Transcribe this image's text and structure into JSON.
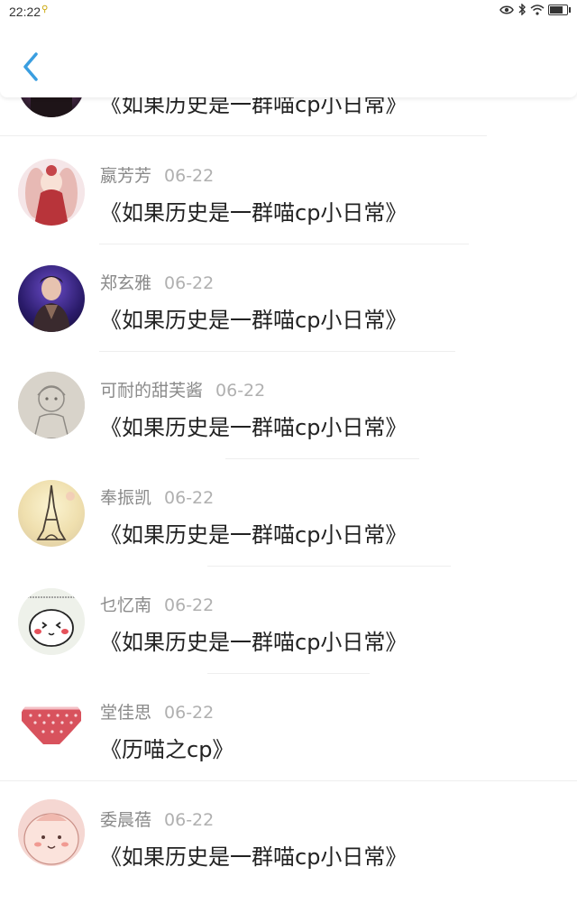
{
  "status": {
    "time": "22:22",
    "battery_level": 0.7
  },
  "nav": {
    "back_icon": "chevron-left-icon",
    "accent": "#3a9ee0"
  },
  "items": [
    {
      "title": "《如果历史是一群喵cp小日常》"
    },
    {
      "name": "嬴芳芳",
      "date": "06-22",
      "title": "《如果历史是一群喵cp小日常》"
    },
    {
      "name": "郑玄雅",
      "date": "06-22",
      "title": "《如果历史是一群喵cp小日常》"
    },
    {
      "name": "可耐的甜芙酱",
      "date": "06-22",
      "title": "《如果历史是一群喵cp小日常》"
    },
    {
      "name": "奉振凯",
      "date": "06-22",
      "title": "《如果历史是一群喵cp小日常》"
    },
    {
      "name": "乜忆南",
      "date": "06-22",
      "title": "《如果历史是一群喵cp小日常》"
    },
    {
      "name": "堂佳思",
      "date": "06-22",
      "title": "《历喵之cp》"
    },
    {
      "name": "委晨蓓",
      "date": "06-22",
      "title": "《如果历史是一群喵cp小日常》"
    }
  ]
}
